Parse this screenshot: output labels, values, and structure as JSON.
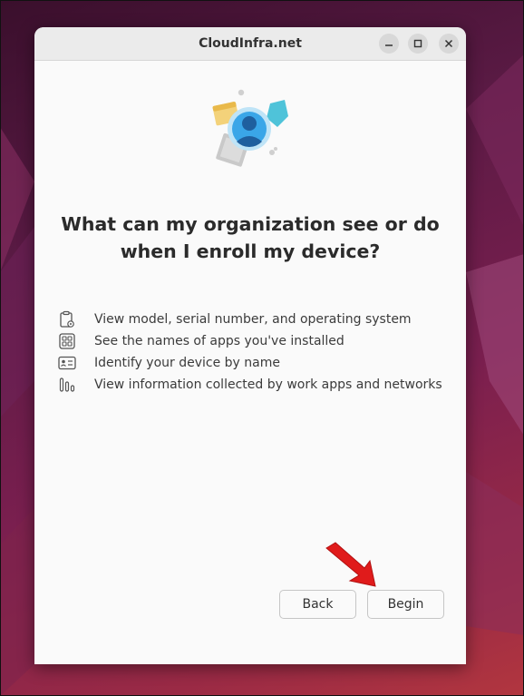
{
  "window": {
    "title": "CloudInfra.net",
    "controls": {
      "minimize": "–",
      "maximize": "□",
      "close": "✕"
    }
  },
  "hero": {
    "icon": "enrollment-illustration-icon"
  },
  "main": {
    "heading_line1": "What can my organization see or do",
    "heading_line2": "when I enroll my device?",
    "items": [
      {
        "icon": "clipboard-gear-icon",
        "label": "View model, serial number, and operating system"
      },
      {
        "icon": "app-grid-icon",
        "label": "See the names of apps you've installed"
      },
      {
        "icon": "id-card-icon",
        "label": "Identify your device by name"
      },
      {
        "icon": "bar-chart-icon",
        "label": "View information collected by work apps and networks"
      }
    ]
  },
  "footer": {
    "back_label": "Back",
    "begin_label": "Begin"
  },
  "colors": {
    "annotation_arrow": "#e01b1b",
    "accent_blue": "#3aa6e8",
    "accent_teal": "#4fc3d9"
  }
}
